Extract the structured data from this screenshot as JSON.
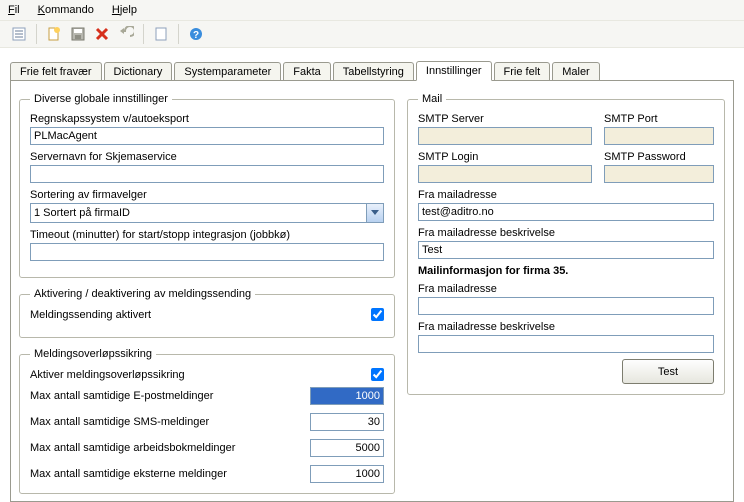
{
  "menubar": {
    "file_u": "F",
    "file_rest": "il",
    "kommando_u": "K",
    "kommando_rest": "ommando",
    "hjelp_u": "H",
    "hjelp_rest": "jelp"
  },
  "tabs": [
    "Frie felt fravær",
    "Dictionary",
    "Systemparameter",
    "Fakta",
    "Tabellstyring",
    "Innstillinger",
    "Frie felt",
    "Maler"
  ],
  "left": {
    "diverse": {
      "legend": "Diverse globale innstillinger",
      "regnskap_label": "Regnskapssystem v/autoeksport",
      "regnskap_value": "PLMacAgent",
      "servernavn_label": "Servernavn for Skjemaservice",
      "servernavn_value": "",
      "sortering_label": "Sortering av firmavelger",
      "sortering_value": "1 Sortert på firmaID",
      "timeout_label": "Timeout (minutter) for start/stopp integrasjon (jobbkø)",
      "timeout_value": ""
    },
    "aktivering": {
      "legend": "Aktivering / deaktivering av meldingssending",
      "meldingssending_label": "Meldingssending aktivert"
    },
    "overlop": {
      "legend": "Meldingsoverløpssikring",
      "aktiver_label": "Aktiver meldingsoverløpssikring",
      "max_epost_label": "Max antall samtidige E-postmeldinger",
      "max_epost_value": "1000",
      "max_sms_label": "Max antall samtidige SMS-meldinger",
      "max_sms_value": "30",
      "max_arbeidsbok_label": "Max antall samtidige arbeidsbokmeldinger",
      "max_arbeidsbok_value": "5000",
      "max_eksterne_label": "Max antall samtidige eksterne meldinger",
      "max_eksterne_value": "1000"
    }
  },
  "right": {
    "mail": {
      "legend": "Mail",
      "smtp_server_label": "SMTP Server",
      "smtp_server_value": "",
      "smtp_port_label": "SMTP Port",
      "smtp_port_value": "",
      "smtp_login_label": "SMTP Login",
      "smtp_login_value": "",
      "smtp_password_label": "SMTP Password",
      "smtp_password_value": "",
      "fra_mail_label": "Fra mailadresse",
      "fra_mail_value": "test@aditro.no",
      "fra_mail_besk_label": "Fra mailadresse beskrivelse",
      "fra_mail_besk_value": "Test",
      "firma_heading": "Mailinformasjon for firma 35.",
      "fra_mail2_label": "Fra mailadresse",
      "fra_mail2_value": "",
      "fra_mail_besk2_label": "Fra mailadresse beskrivelse",
      "fra_mail_besk2_value": "",
      "test_label": "Test"
    }
  }
}
